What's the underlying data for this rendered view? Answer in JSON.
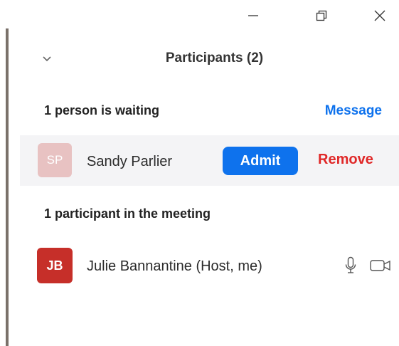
{
  "window_controls": {
    "minimize_icon": "minimize-icon",
    "restore_icon": "restore-icon",
    "close_icon": "close-icon"
  },
  "panel": {
    "title": "Participants (2)",
    "collapse_icon": "chevron-down-icon"
  },
  "waiting": {
    "heading": "1 person is waiting",
    "message_label": "Message",
    "people": [
      {
        "initials": "SP",
        "name": "Sandy Parlier",
        "admit_label": "Admit",
        "remove_label": "Remove",
        "avatar_color": "#e8c2c2"
      }
    ]
  },
  "in_meeting": {
    "heading": "1 participant in the meeting",
    "people": [
      {
        "initials": "JB",
        "name": "Julie Bannantine (Host, me)",
        "avatar_color": "#c62f29",
        "mic_icon": "microphone-icon",
        "video_icon": "video-camera-icon"
      }
    ]
  },
  "colors": {
    "accent": "#0e72ed",
    "danger": "#e02828",
    "row_highlight": "#f4f4f6"
  }
}
